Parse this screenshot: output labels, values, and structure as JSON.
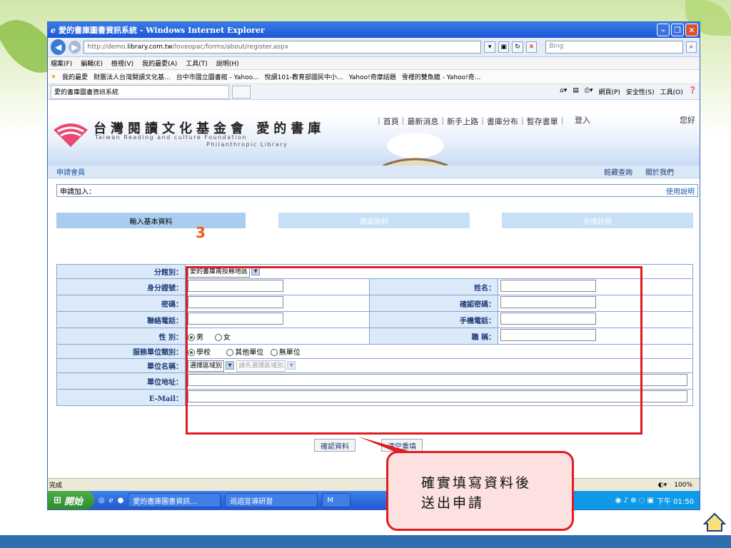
{
  "window": {
    "title": "愛的書庫圖書資訊系統 - Windows Internet Explorer",
    "address_prefix": "http://demo.",
    "address_domain": "library.com.tw",
    "address_path": "/loveopac/forms/about/register.aspx",
    "search_placeholder": "Bing"
  },
  "menu": [
    "檔案(F)",
    "編輯(E)",
    "檢視(V)",
    "我的最愛(A)",
    "工具(T)",
    "說明(H)"
  ],
  "favorites": {
    "label": "我的最愛",
    "items": [
      "財團法人台灣閱讀文化基...",
      "台中市國立圖書館 - Yahoo...",
      "悅讀101-教育部國民中小...",
      "Yahoo!奇摩話題",
      "雪裡的雙魚鏡 - Yahoo!奇..."
    ]
  },
  "tab": {
    "label": "愛的書庫圖書資訊系統",
    "commands": [
      "網頁(P)",
      "安全性(S)",
      "工具(O)"
    ]
  },
  "site": {
    "title": "台灣閱讀文化基金會  愛的書庫",
    "sub1": "Taiwan Reading and culture Foundation",
    "sub2": "Philanthropic Library",
    "nav": [
      "首頁",
      "最新消息",
      "新手上路",
      "書庫分布",
      "暫存書單"
    ],
    "login": "登入",
    "hello": "您好"
  },
  "apply_bar": {
    "label": "申請會員",
    "links": [
      "館藏查詢",
      "關於我們"
    ]
  },
  "join": {
    "label": "申請加入：",
    "help": "使用說明"
  },
  "steps": [
    "輸入基本資料",
    "確認資料",
    "完成註冊"
  ],
  "step_number": "3",
  "form": {
    "branch_label": "分館別：",
    "branch_value": "愛的書庫南投縣地區",
    "id_label": "身分證號：",
    "name_label": "姓名：",
    "password_label": "密碼：",
    "confirm_password_label": "確認密碼：",
    "phone_label": "聯絡電話：",
    "mobile_label": "手機電話：",
    "gender_label": "性 別：",
    "gender_male": "男",
    "gender_female": "女",
    "title_label": "職 稱：",
    "unit_type_label": "服務單位類別：",
    "unit_type_school": "學校",
    "unit_type_other": "其他單位",
    "unit_type_none": "無單位",
    "unit_name_label": "單位名稱：",
    "unit_region_select": "選擇區域別",
    "unit_name_select": "請先選擇區域別",
    "unit_address_label": "單位地址：",
    "email_label": "E-Mail："
  },
  "buttons": {
    "confirm": "確認資料",
    "clear": "清空重填"
  },
  "status": {
    "text": "完成",
    "zoom": "100%"
  },
  "taskbar": {
    "start": "開始",
    "tasks": [
      "愛的書庫圖書資訊...",
      "巡迴宣導研習",
      "M"
    ],
    "clock": "下午 01:50"
  },
  "callout": {
    "line1": "確實填寫資料後",
    "line2": "送出申請"
  },
  "colors": {
    "highlight_red": "#e11b22",
    "step_orange": "#f05a1a",
    "link_blue": "#1e5aa8"
  }
}
